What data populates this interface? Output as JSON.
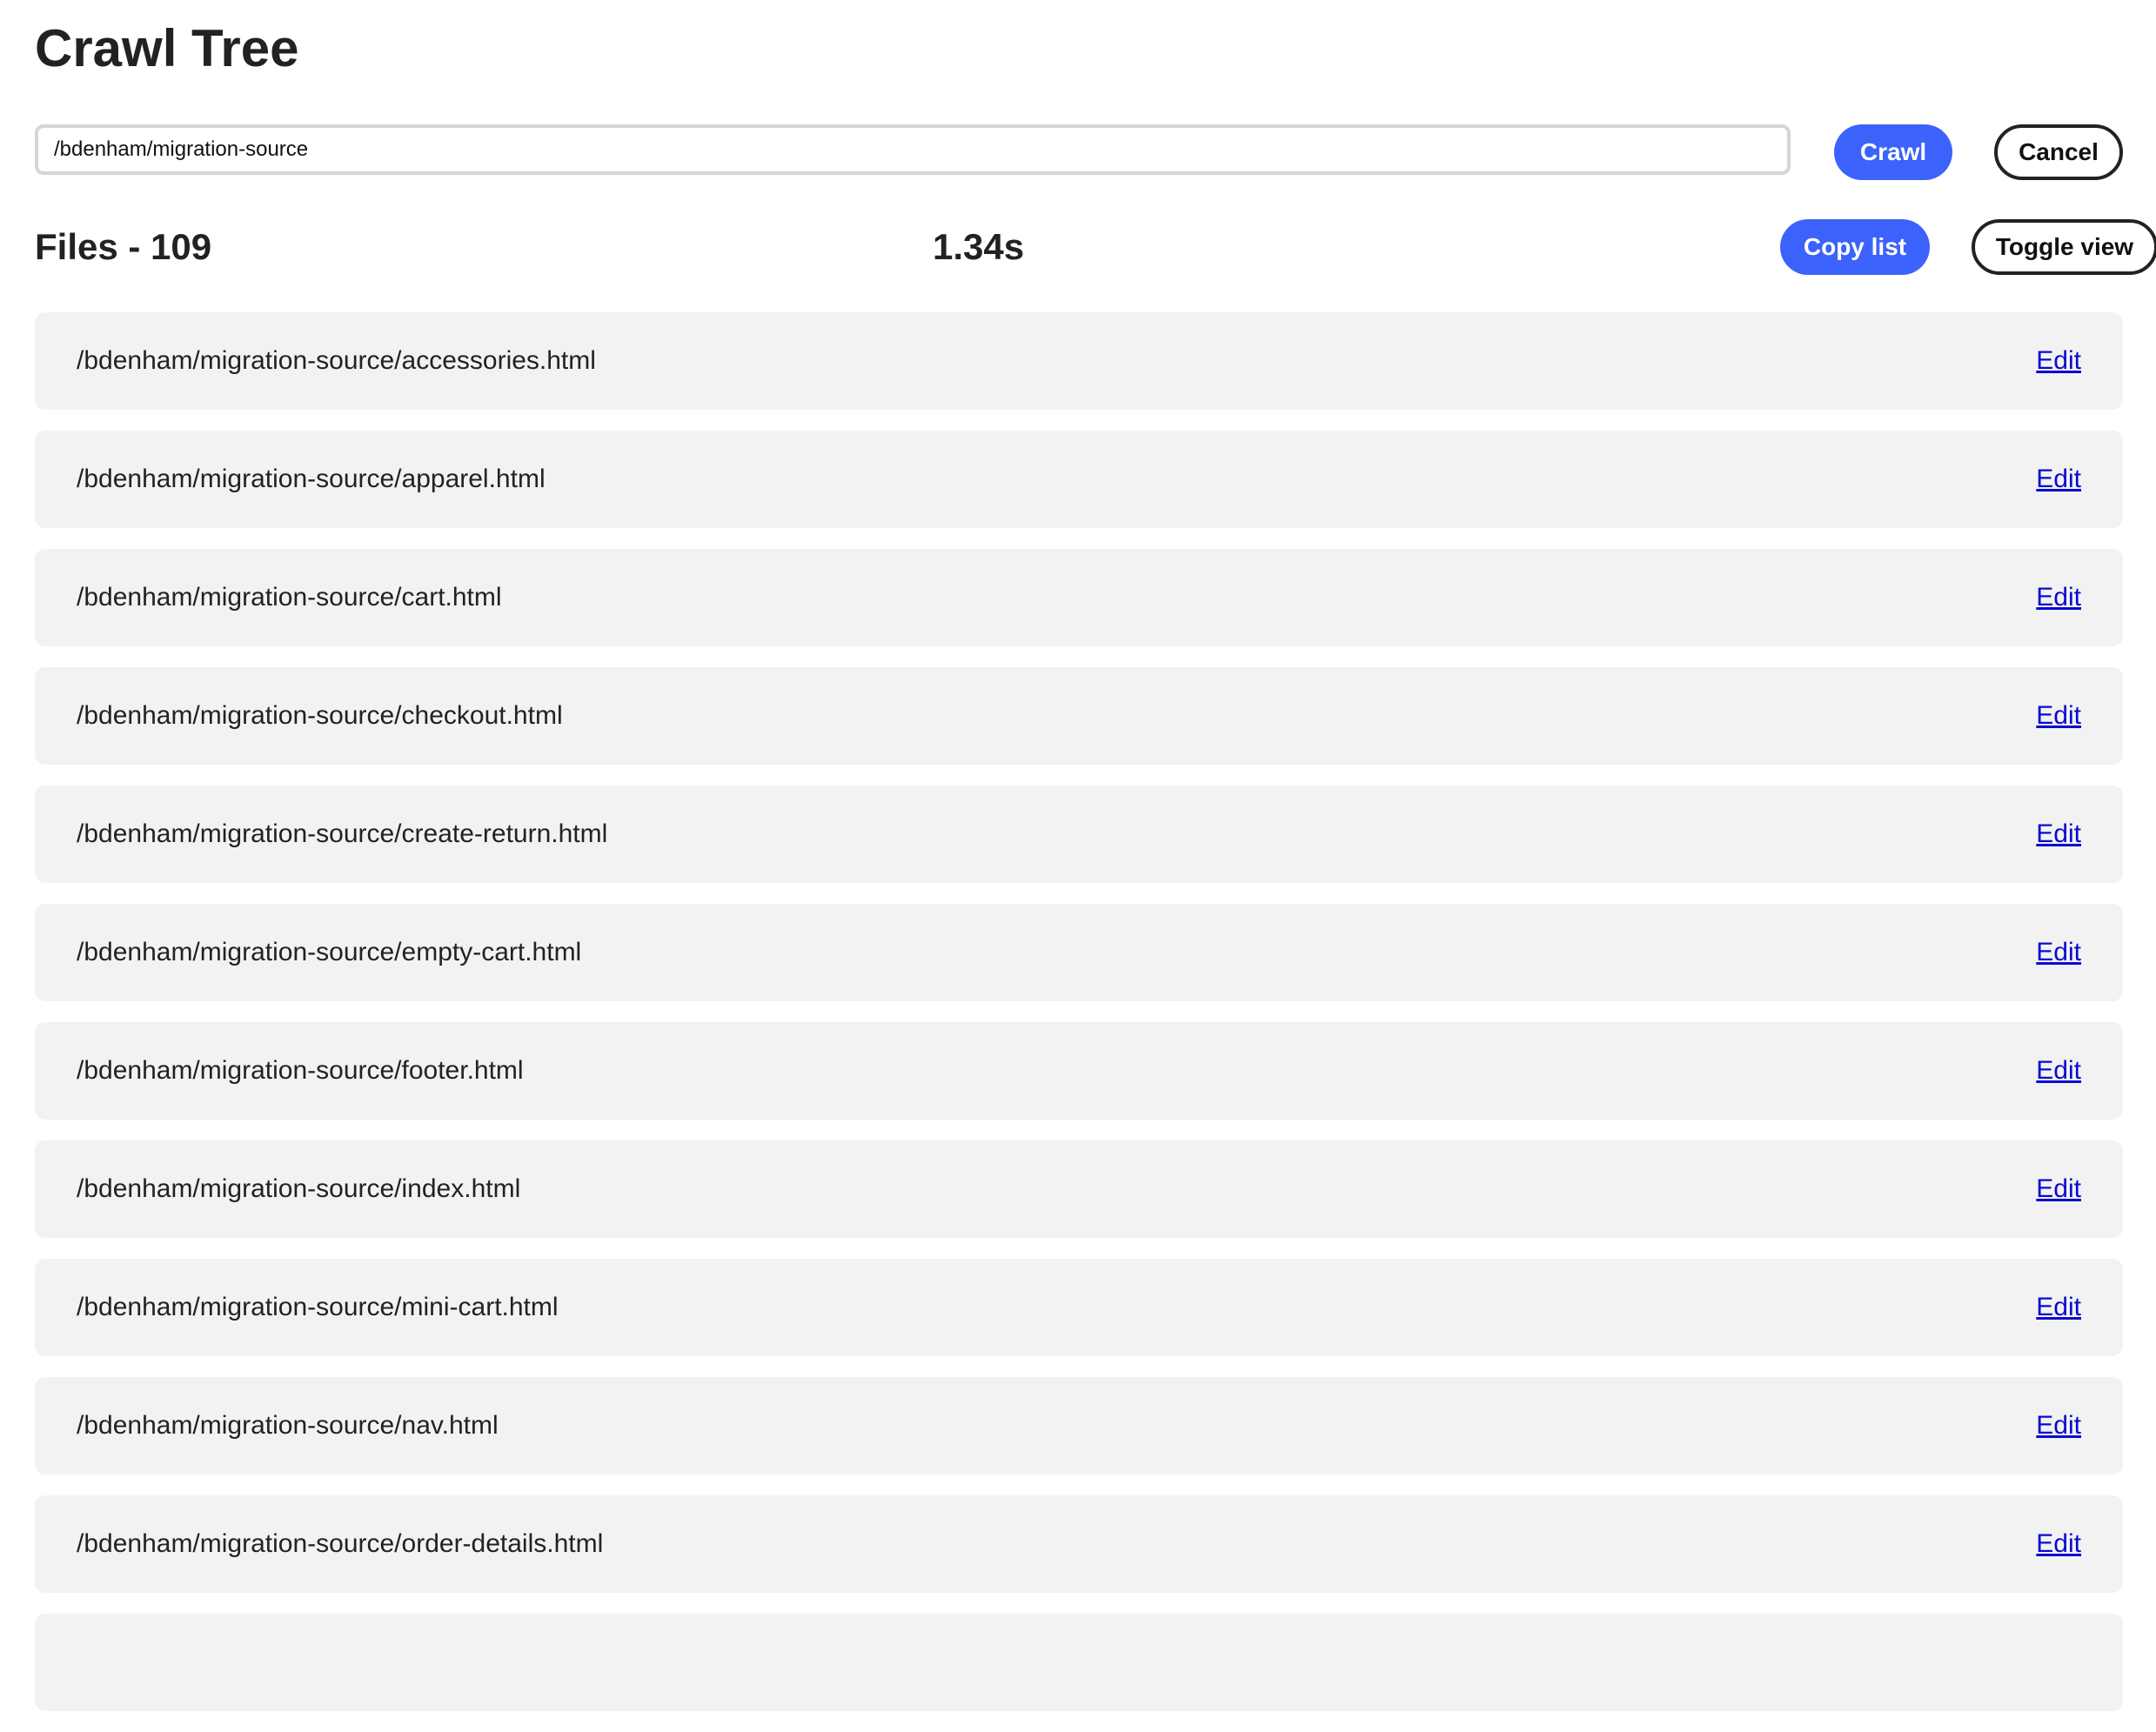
{
  "page": {
    "title": "Crawl Tree"
  },
  "crawl_form": {
    "path_value": "/bdenham/migration-source",
    "crawl_label": "Crawl",
    "cancel_label": "Cancel"
  },
  "results_header": {
    "files_count_label": "Files - 109",
    "elapsed_time": "1.34s",
    "copy_list_label": "Copy list",
    "toggle_view_label": "Toggle view"
  },
  "files": [
    {
      "path": "/bdenham/migration-source/accessories.html",
      "action": "Edit"
    },
    {
      "path": "/bdenham/migration-source/apparel.html",
      "action": "Edit"
    },
    {
      "path": "/bdenham/migration-source/cart.html",
      "action": "Edit"
    },
    {
      "path": "/bdenham/migration-source/checkout.html",
      "action": "Edit"
    },
    {
      "path": "/bdenham/migration-source/create-return.html",
      "action": "Edit"
    },
    {
      "path": "/bdenham/migration-source/empty-cart.html",
      "action": "Edit"
    },
    {
      "path": "/bdenham/migration-source/footer.html",
      "action": "Edit"
    },
    {
      "path": "/bdenham/migration-source/index.html",
      "action": "Edit"
    },
    {
      "path": "/bdenham/migration-source/mini-cart.html",
      "action": "Edit"
    },
    {
      "path": "/bdenham/migration-source/nav.html",
      "action": "Edit"
    },
    {
      "path": "/bdenham/migration-source/order-details.html",
      "action": "Edit"
    },
    {
      "path": "",
      "action": ""
    }
  ],
  "colors": {
    "primary_button": "#3b63fb",
    "row_background": "#f2f2f2",
    "link": "#0a0ad1",
    "text": "#222222"
  }
}
